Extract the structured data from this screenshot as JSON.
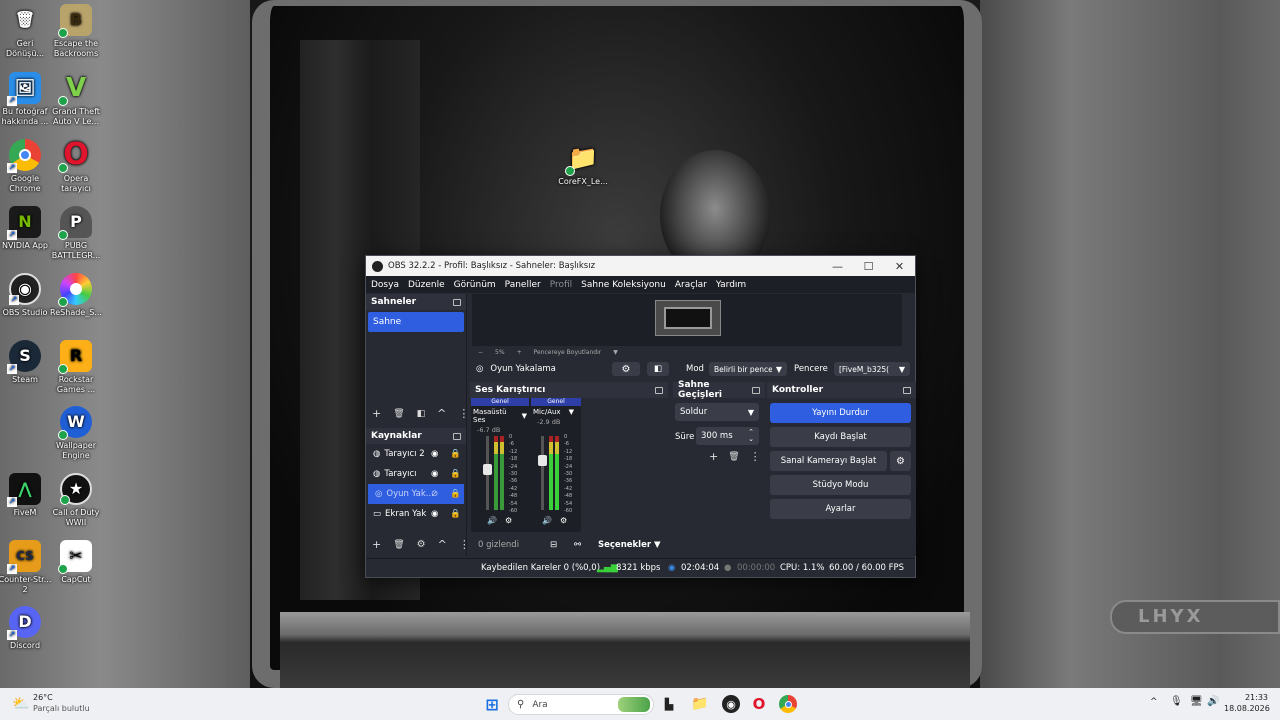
{
  "desktop": {
    "icons": [
      {
        "label": "Geri Dönüşü...",
        "glyph": "🗑"
      },
      {
        "label": "Escape the Backrooms",
        "glyph": "B"
      },
      {
        "label": "Bu fotoğraf hakkında ...",
        "glyph": "🖼"
      },
      {
        "label": "Grand Theft Auto V Le...",
        "glyph": "V"
      },
      {
        "label": "Google Chrome",
        "glyph": ""
      },
      {
        "label": "Opera tarayıcı",
        "glyph": "O"
      },
      {
        "label": "NVIDIA App",
        "glyph": "N"
      },
      {
        "label": "PUBG BATTLEGR...",
        "glyph": "P"
      },
      {
        "label": "OBS Studio",
        "glyph": "◉"
      },
      {
        "label": "ReShade_S...",
        "glyph": ""
      },
      {
        "label": "Steam",
        "glyph": "S"
      },
      {
        "label": "Rockstar Games ...",
        "glyph": "R"
      },
      {
        "label": "Wallpaper Engine",
        "glyph": "W"
      },
      {
        "label": "FiveM",
        "glyph": "⋀"
      },
      {
        "label": "Call of Duty WWII",
        "glyph": "★"
      },
      {
        "label": "Counter-Str... 2",
        "glyph": "CS"
      },
      {
        "label": "CapCut",
        "glyph": "✂"
      },
      {
        "label": "Discord",
        "glyph": "D"
      },
      {
        "label": "CoreFX_Le...",
        "glyph": "📁"
      }
    ],
    "colors": {
      "chrome": "#ea4335",
      "opera": "#e0142d",
      "nvidia": "#76b900",
      "steam": "#1b2838",
      "discord": "#5865f2",
      "accent": "#2f5ee0"
    }
  },
  "obs": {
    "title": "OBS 32.2.2 - Profil: Başlıksız - Sahneler: Başlıksız",
    "window_controls": {
      "minimize": "—",
      "maximize": "☐",
      "close": "✕"
    },
    "menu": [
      "Dosya",
      "Düzenle",
      "Görünüm",
      "Paneller",
      "Profil",
      "Sahne Koleksiyonu",
      "Araçlar",
      "Yardım"
    ],
    "preview": {
      "zoom_minus": "−",
      "zoom": "5%",
      "zoom_plus": "+",
      "scale_mode": "Pencereye Boyutlandır"
    },
    "source_bar": {
      "source_name": "Oyun Yakalama",
      "mode_label": "Mod",
      "mode_value": "Belirli bir pencer",
      "window_label": "Pencere",
      "window_value": "[FiveM_b325("
    },
    "scenes": {
      "title": "Sahneler",
      "items": [
        "Sahne"
      ]
    },
    "sources": {
      "title": "Kaynaklar",
      "items": [
        "Tarayıcı 2",
        "Tarayıcı",
        "Oyun Yak...",
        "Ekran Yak"
      ],
      "hidden_count": "0 gizlendi"
    },
    "mixer": {
      "title": "Ses Karıştırıcı",
      "channels": [
        {
          "group": "Genel",
          "name": "Masaüstü Ses",
          "db": "-6.7 dB",
          "level": 0.55
        },
        {
          "group": "Genel",
          "name": "Mic/Aux",
          "db": "-2.9 dB",
          "level": 0.7
        }
      ],
      "scale": [
        "0",
        "-6",
        "-12",
        "-18",
        "-24",
        "-30",
        "-36",
        "-42",
        "-48",
        "-54",
        "-60"
      ],
      "options_label": "Seçenekler"
    },
    "transitions": {
      "title": "Sahne Geçişleri",
      "selected": "Soldur",
      "duration_label": "Süre",
      "duration_value": "300 ms"
    },
    "controls": {
      "title": "Kontroller",
      "buttons": [
        "Yayını Durdur",
        "Kaydı Başlat",
        "Sanal Kamerayı Başlat",
        "Stüdyo Modu",
        "Ayarlar"
      ]
    },
    "status": {
      "dropped": "Kaybedilen Kareler 0 (%0,0)",
      "bitrate": "8321 kbps",
      "stream_time": "02:04:04",
      "rec_time": "00:00:00",
      "cpu": "CPU: 1.1%",
      "fps": "60.00 / 60.00 FPS"
    }
  },
  "taskbar": {
    "weather_temp": "26°C",
    "weather_text": "Parçalı bulutlu",
    "search_placeholder": "Ara",
    "time": "21:33",
    "date": "18.08.2026"
  }
}
